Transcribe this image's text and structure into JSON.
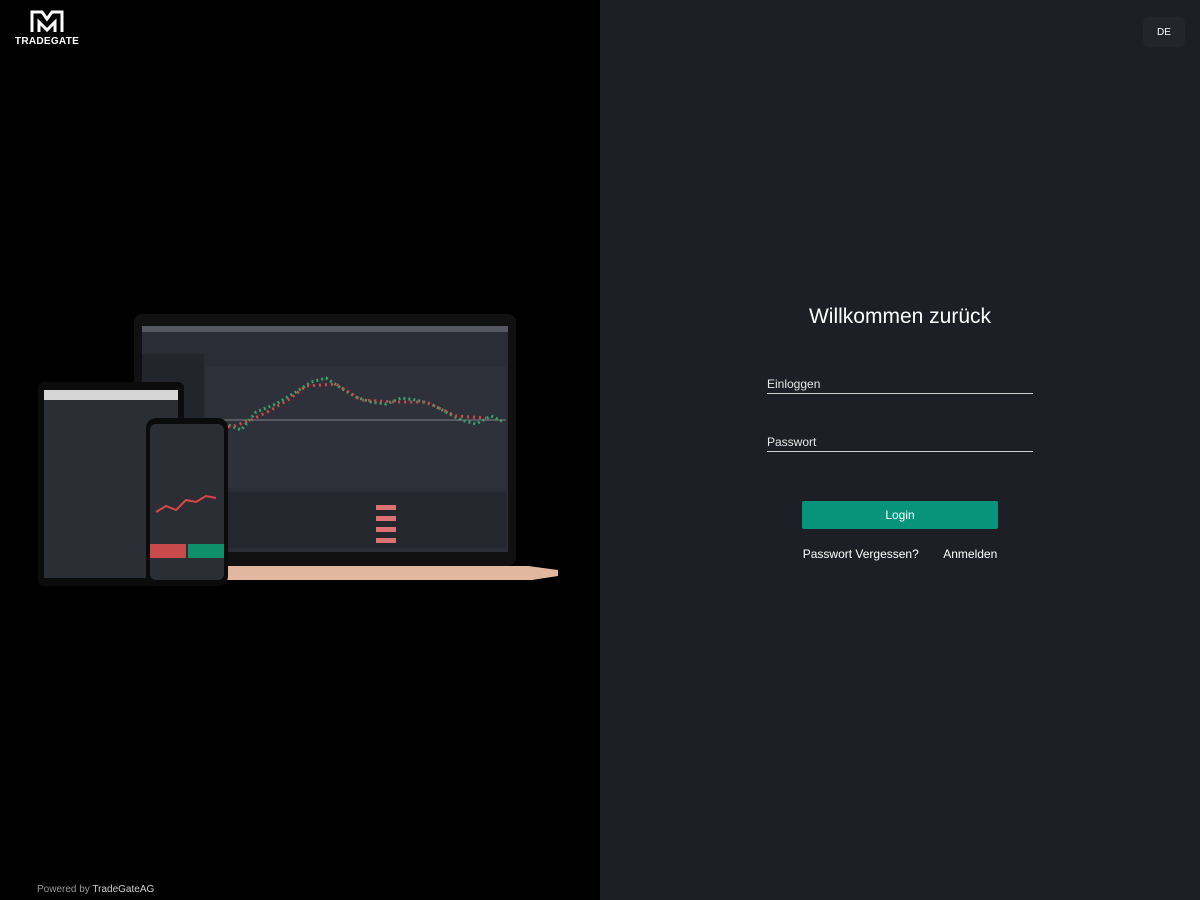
{
  "brand": {
    "name": "TRADEGATE"
  },
  "footer": {
    "powered_prefix": "Powered by ",
    "powered_company": "TradeGateAG"
  },
  "language": {
    "current": "DE"
  },
  "login": {
    "title": "Willkommen zurück",
    "username_placeholder": "Einloggen",
    "password_placeholder": "Passwort",
    "submit_label": "Login",
    "forgot_label": "Passwort Vergessen?",
    "register_label": "Anmelden"
  },
  "colors": {
    "accent": "#07947a",
    "left_bg": "#000000",
    "right_bg": "#1e1f26"
  }
}
